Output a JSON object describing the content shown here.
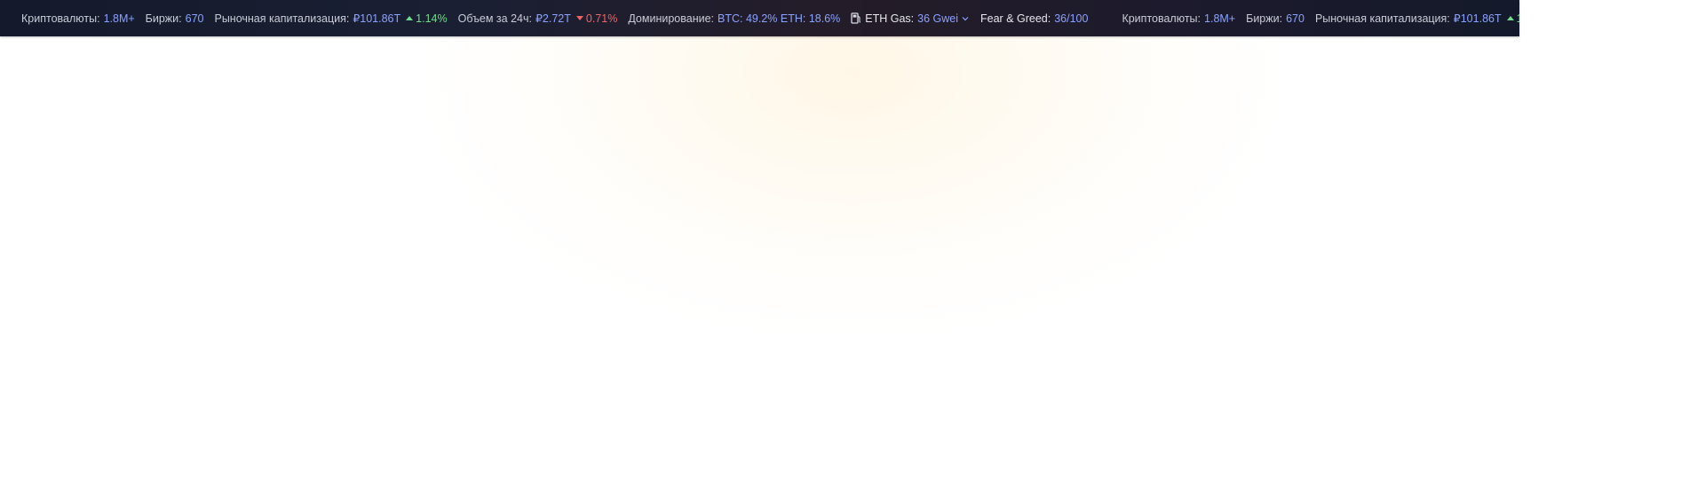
{
  "colors": {
    "bar_bg": "#1a1f33",
    "label": "#c9ccd6",
    "value": "#8aa2ff",
    "positive": "#6fdc8c",
    "negative": "#f06363"
  },
  "ticker": {
    "cryptos_label": "Криптовалюты:",
    "cryptos_value": "1.8M+",
    "exchanges_label": "Биржи:",
    "exchanges_value": "670",
    "market_cap_label": "Рыночная капитализация:",
    "market_cap_value": "₽101.86T",
    "market_cap_change": "1.14%",
    "volume_label": "Объем за 24ч:",
    "volume_value": "₽2.72T",
    "volume_change": "0.71%",
    "dominance_label": "Доминирование:",
    "dominance_value": "BTC: 49.2% ETH: 18.6%",
    "gas_label": "ETH Gas:",
    "gas_value": "36 Gwei",
    "gas_icon": "gas-pump-icon",
    "fear_greed_label": "Fear & Greed:",
    "fear_greed_value": "36/100"
  }
}
